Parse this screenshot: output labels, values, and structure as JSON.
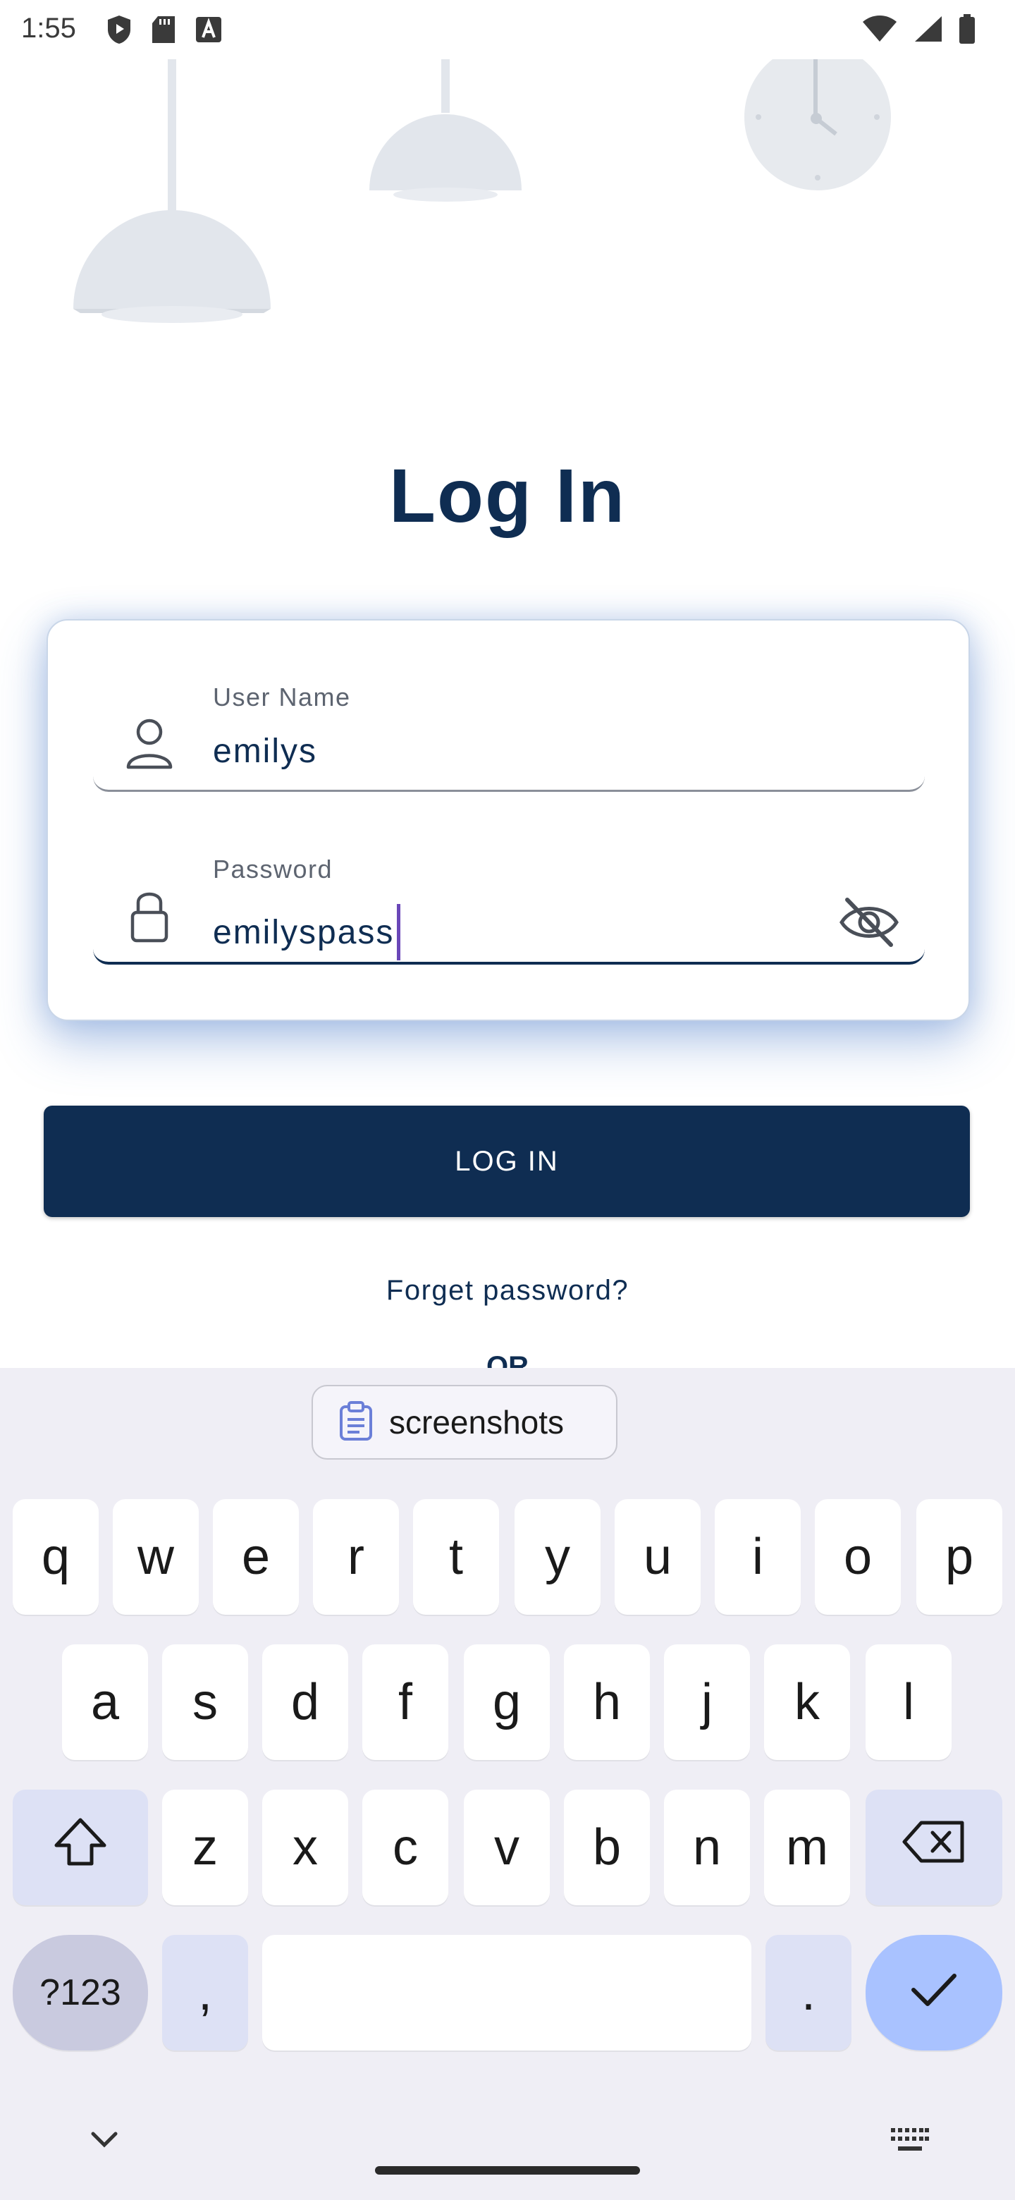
{
  "status_bar": {
    "time": "1:55",
    "left_icons": [
      "shield-icon",
      "sd-card-icon",
      "font-a-icon"
    ],
    "right_icons": [
      "wifi-icon",
      "signal-icon",
      "battery-icon"
    ]
  },
  "page": {
    "title": "Log In",
    "login_button_label": "LOG IN",
    "forgot_password_label": "Forget password?",
    "or_label": "OR"
  },
  "form": {
    "username": {
      "label": "User Name",
      "value": "emilys",
      "icon": "person-icon"
    },
    "password": {
      "label": "Password",
      "value": "emilyspass",
      "icon": "lock-icon",
      "toggle_icon": "eye-off-icon"
    }
  },
  "keyboard": {
    "clipboard_suggestion": "screenshots",
    "row1": [
      "q",
      "w",
      "e",
      "r",
      "t",
      "y",
      "u",
      "i",
      "o",
      "p"
    ],
    "row2": [
      "a",
      "s",
      "d",
      "f",
      "g",
      "h",
      "j",
      "k",
      "l"
    ],
    "row3": [
      "z",
      "x",
      "c",
      "v",
      "b",
      "n",
      "m"
    ],
    "symbols_label": "?123",
    "comma_label": ",",
    "period_label": "."
  },
  "colors": {
    "primary": "#0f2d52",
    "card_glow": "#4678c8",
    "caret": "#6a47b8",
    "keyboard_bg": "#efeef5",
    "enter_key": "#a9c2ff"
  }
}
